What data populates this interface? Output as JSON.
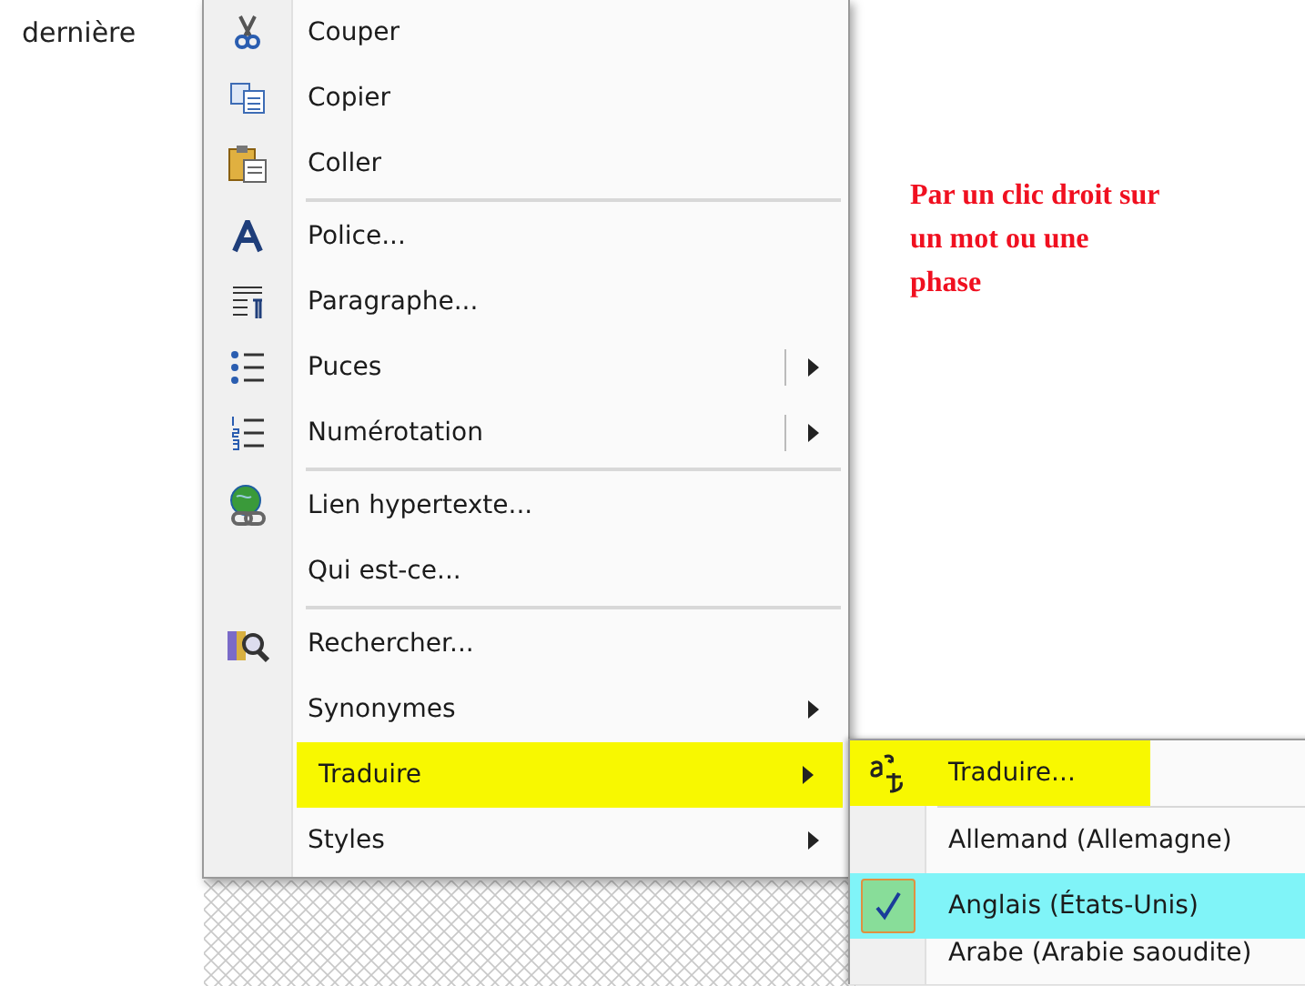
{
  "document": {
    "text": "dernière",
    "note": "Par un clic droit sur un mot ou une phase"
  },
  "context_menu": {
    "groups": [
      [
        {
          "label": "Couper",
          "kind": "plain",
          "selected": false
        },
        {
          "label": "Copier",
          "kind": "plain",
          "selected": false
        },
        {
          "label": "Coller",
          "kind": "plain",
          "selected": false
        }
      ],
      [
        {
          "label": "Police...",
          "kind": "plain",
          "selected": false
        },
        {
          "label": "Paragraphe...",
          "kind": "plain",
          "selected": false
        },
        {
          "label": "Puces",
          "kind": "split",
          "selected": false
        },
        {
          "label": "Numérotation",
          "kind": "split",
          "selected": false
        }
      ],
      [
        {
          "label": "Lien hypertexte...",
          "kind": "plain",
          "selected": false
        },
        {
          "label": "Qui est-ce...",
          "kind": "plain",
          "selected": false
        }
      ],
      [
        {
          "label": "Rechercher...",
          "kind": "plain",
          "selected": false
        },
        {
          "label": "Synonymes",
          "kind": "submenu",
          "selected": false
        },
        {
          "label": "Traduire",
          "kind": "submenu",
          "selected": true
        },
        {
          "label": "Styles",
          "kind": "submenu",
          "selected": false
        }
      ]
    ]
  },
  "submenu": {
    "groups": [
      [
        {
          "label": "Traduire...",
          "kind": "command",
          "checked": false,
          "selected": true
        }
      ],
      [
        {
          "label": "Allemand (Allemagne)",
          "kind": "language",
          "checked": false,
          "selected": false
        },
        {
          "label": "Anglais (États-Unis)",
          "kind": "language",
          "checked": true,
          "selected": false
        },
        {
          "label": "Arabe (Arabie saoudite)",
          "kind": "language",
          "checked": false,
          "selected": false
        }
      ]
    ]
  }
}
